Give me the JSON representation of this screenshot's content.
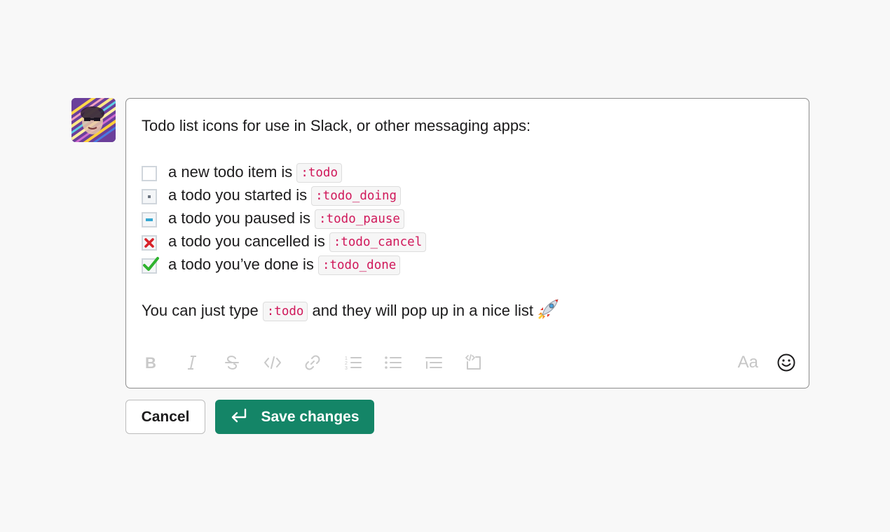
{
  "message": {
    "intro": "Todo list icons for use in Slack, or other messaging apps:",
    "items": [
      {
        "icon": "todo-empty-icon",
        "text": "a new todo item is",
        "code": ":todo"
      },
      {
        "icon": "todo-doing-icon",
        "text": "a todo you started is",
        "code": ":todo_doing"
      },
      {
        "icon": "todo-pause-icon",
        "text": "a todo you paused is",
        "code": ":todo_pause"
      },
      {
        "icon": "todo-cancel-icon",
        "text": "a todo you cancelled is",
        "code": ":todo_cancel"
      },
      {
        "icon": "todo-done-icon",
        "text": "a todo you’ve done is",
        "code": ":todo_done"
      }
    ],
    "outro_before": "You can just type",
    "outro_code": ":todo",
    "outro_after": "and they will pop up in a nice list",
    "outro_emoji": "rocket-icon"
  },
  "toolbar": {
    "items": [
      "bold-icon",
      "italic-icon",
      "strikethrough-icon",
      "code-icon",
      "link-icon",
      "ordered-list-icon",
      "bulleted-list-icon",
      "blockquote-icon",
      "code-block-icon"
    ],
    "format_label": "Aa",
    "emoji_icon": "emoji-icon"
  },
  "actions": {
    "cancel_label": "Cancel",
    "save_label": "Save changes"
  },
  "colors": {
    "save_button": "#148567",
    "code_text": "#d0185a",
    "cancel_red": "#d8232a",
    "done_green": "#2fb32f"
  }
}
